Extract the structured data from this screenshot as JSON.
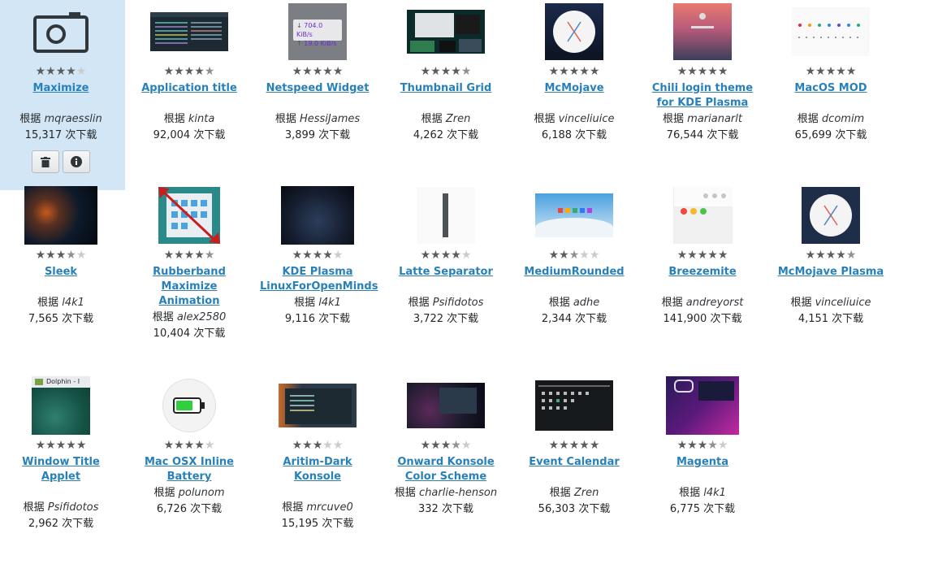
{
  "byline_prefix": "根据",
  "downloads_suffix": "次下载",
  "selected_actions": [
    "trash-icon",
    "info-icon"
  ],
  "items": [
    {
      "title": "Maximize",
      "author": "mqraesslin",
      "downloads": "15,317",
      "rating": 4,
      "selected": true
    },
    {
      "title": "Application title",
      "author": "kinta",
      "downloads": "92,004",
      "rating": 4.5
    },
    {
      "title": "Netspeed Widget",
      "author": "HessiJames",
      "downloads": "3,899",
      "rating": 5,
      "thumb_text": [
        "704.0 KiB/s",
        "19.0 KiB/s"
      ]
    },
    {
      "title": "Thumbnail Grid",
      "author": "Zren",
      "downloads": "4,262",
      "rating": 4.5
    },
    {
      "title": "McMojave",
      "author": "vinceliuice",
      "downloads": "6,188",
      "rating": 5
    },
    {
      "title": "Chili login theme for KDE Plasma",
      "author": "marianarlt",
      "downloads": "76,544",
      "rating": 5
    },
    {
      "title": "MacOS MOD",
      "author": "dcomim",
      "downloads": "65,699",
      "rating": 5
    },
    {
      "title": "Sleek",
      "author": "l4k1",
      "downloads": "7,565",
      "rating": 3.5
    },
    {
      "title": "Rubberband Maximize Animation",
      "author": "alex2580",
      "downloads": "10,404",
      "rating": 4.5
    },
    {
      "title": "KDE Plasma LinuxForOpenMinds",
      "author": "l4k1",
      "downloads": "9,116",
      "rating": 4
    },
    {
      "title": "Latte Separator",
      "author": "Psifidotos",
      "downloads": "3,722",
      "rating": 4
    },
    {
      "title": "MediumRounded",
      "author": "adhe",
      "downloads": "2,344",
      "rating": 2.5
    },
    {
      "title": "Breezemite",
      "author": "andreyorst",
      "downloads": "141,900",
      "rating": 5
    },
    {
      "title": "McMojave Plasma",
      "author": "vinceliuice",
      "downloads": "4,151",
      "rating": 4.5
    },
    {
      "title": "Window Title Applet",
      "author": "Psifidotos",
      "downloads": "2,962",
      "rating": 5,
      "thumb_text": [
        "Dolphin - I"
      ]
    },
    {
      "title": "Mac OSX Inline Battery",
      "author": "polunom",
      "downloads": "6,726",
      "rating": 4
    },
    {
      "title": "Aritim-Dark Konsole",
      "author": "mrcuve0",
      "downloads": "15,195",
      "rating": 3
    },
    {
      "title": "Onward Konsole Color Scheme",
      "author": "charlie-henson",
      "downloads": "332",
      "rating": 3.5
    },
    {
      "title": "Event Calendar",
      "author": "Zren",
      "downloads": "56,303",
      "rating": 5
    },
    {
      "title": "Magenta",
      "author": "l4k1",
      "downloads": "6,775",
      "rating": 3.5
    }
  ]
}
